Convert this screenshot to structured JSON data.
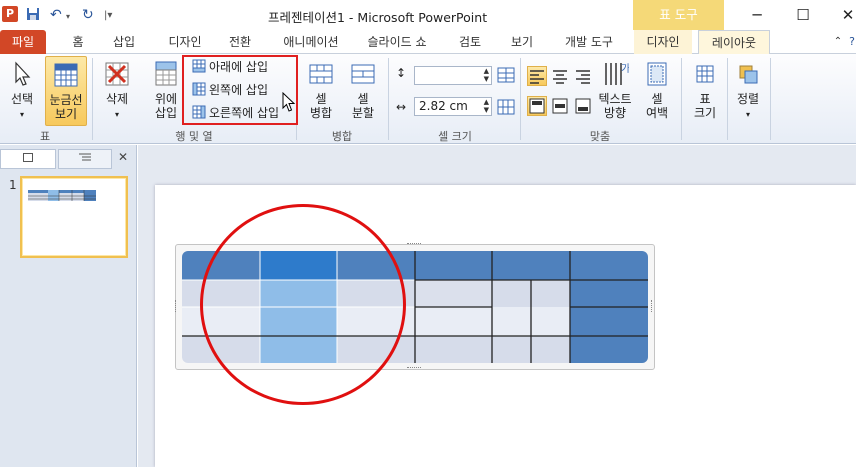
{
  "window": {
    "app_icon": "P",
    "title": "프레젠테이션1 - Microsoft PowerPoint",
    "contextual_tab_group": "표 도구"
  },
  "tabs": [
    "파일",
    "홈",
    "삽입",
    "디자인",
    "전환",
    "애니메이션",
    "슬라이드 쇼",
    "검토",
    "보기",
    "개발 도구",
    "디자인",
    "레이아웃"
  ],
  "ribbon": {
    "table_group": {
      "label": "표",
      "select": "선택",
      "gridlines_line1": "눈금선",
      "gridlines_line2": "보기"
    },
    "rows_cols_group": {
      "label": "행 및 열",
      "delete": "삭제",
      "insert_above_line1": "위에",
      "insert_above_line2": "삽입",
      "insert_below": "아래에 삽입",
      "insert_left": "왼쪽에 삽입",
      "insert_right": "오른쪽에 삽입"
    },
    "merge_group": {
      "label": "병합",
      "merge_line1": "셀",
      "merge_line2": "병합",
      "split_line1": "셀",
      "split_line2": "분할"
    },
    "cell_size_group": {
      "label": "셀 크기",
      "height_value": "",
      "width_value": "2.82 cm"
    },
    "alignment_group": {
      "label": "맞춤",
      "text_direction_line1": "텍스트",
      "text_direction_line2": "방향",
      "cell_margins_line1": "셀",
      "cell_margins_line2": "여백"
    },
    "table_size_group": {
      "label_line1": "표",
      "label_line2": "크기"
    },
    "arrange_group": {
      "label": "정렬"
    }
  },
  "slides_panel": {
    "slide_number": "1",
    "close_glyph": "✕"
  },
  "colors": {
    "header_blue": "#4f81bd",
    "selected_header_blue": "#2e7bcb",
    "selected_col": "#8fbde8",
    "band_light": "#d6dcea",
    "band_lighter": "#e9edf5",
    "annotation_red": "#e01010"
  },
  "icons": {
    "minimize": "─",
    "maximize": "☐",
    "close": "✕"
  }
}
